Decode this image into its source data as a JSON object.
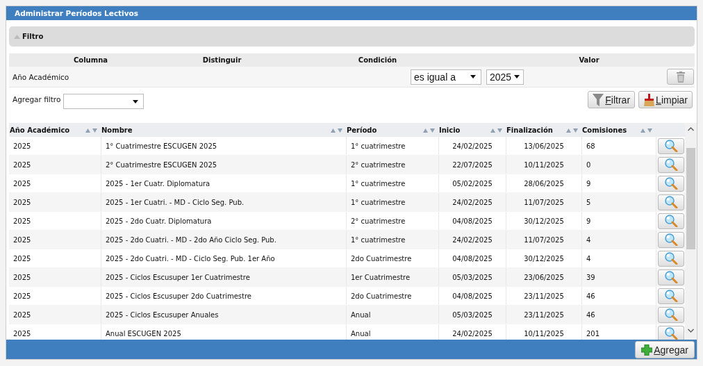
{
  "window": {
    "title": "Administrar Períodos Lectivos"
  },
  "filter": {
    "title": "Filtro",
    "expanded": true,
    "columns": [
      "Columna",
      "Distinguir",
      "Condición",
      "Valor"
    ],
    "rows": [
      {
        "column": "Año Académico",
        "condition": "es igual a",
        "value": "2025"
      }
    ],
    "add_filter_label": "Agregar filtro",
    "buttons": [
      {
        "kind": "filter",
        "label": "Filtrar"
      },
      {
        "kind": "clear",
        "label": "Limpiar"
      }
    ]
  },
  "table": {
    "columns": [
      "Año Académico",
      "Nombre",
      "Período",
      "Inicio",
      "Finalización",
      "Comisiones"
    ],
    "rows": [
      {
        "cells": [
          "2025",
          "1° Cuatrimestre ESCUGEN 2025",
          "1° cuatrimestre",
          "24/02/2025",
          "13/06/2025",
          "68"
        ]
      },
      {
        "cells": [
          "2025",
          "2° Cuatrimestre ESCUGEN 2025",
          "2° cuatrimestre",
          "22/07/2025",
          "10/11/2025",
          "0"
        ]
      },
      {
        "cells": [
          "2025",
          "2025 - 1er Cuatr. Diplomatura",
          "1° cuatrimestre",
          "05/02/2025",
          "28/06/2025",
          "9"
        ]
      },
      {
        "cells": [
          "2025",
          "2025 - 1er Cuatri. - MD - Ciclo Seg. Pub.",
          "1° cuatrimestre",
          "24/02/2025",
          "11/07/2025",
          "5"
        ]
      },
      {
        "cells": [
          "2025",
          "2025 - 2do Cuatr. Diplomatura",
          "2° cuatrimestre",
          "04/08/2025",
          "30/12/2025",
          "9"
        ]
      },
      {
        "cells": [
          "2025",
          "2025 - 2do Cuatri. - MD - 2do Año Ciclo Seg. Pub.",
          "1° cuatrimestre",
          "24/02/2025",
          "11/07/2025",
          "4"
        ]
      },
      {
        "cells": [
          "2025",
          "2025 - 2do Cuatri. - MD - Ciclo Seg. Pub. 1er Año",
          "2do Cuatrimestre",
          "04/08/2025",
          "30/12/2025",
          "4"
        ]
      },
      {
        "cells": [
          "2025",
          "2025 - Ciclos Escusuper 1er Cuatrimestre",
          "1er Cuatrimestre",
          "05/03/2025",
          "23/06/2025",
          "39"
        ]
      },
      {
        "cells": [
          "2025",
          "2025 - Ciclos Escusuper 2do Cuatrimestre",
          "2do Cuatrimestre",
          "04/08/2025",
          "23/11/2025",
          "46"
        ]
      },
      {
        "cells": [
          "2025",
          "2025 - Ciclos Escusuper Anuales",
          "Anual",
          "05/03/2025",
          "23/11/2025",
          "46"
        ]
      },
      {
        "cells": [
          "2025",
          "Anual ESCUGEN 2025",
          "Anual",
          "24/02/2025",
          "10/11/2025",
          "201"
        ]
      }
    ]
  },
  "footer": {
    "buttons": [
      {
        "kind": "add",
        "label": "Agregar"
      }
    ]
  }
}
